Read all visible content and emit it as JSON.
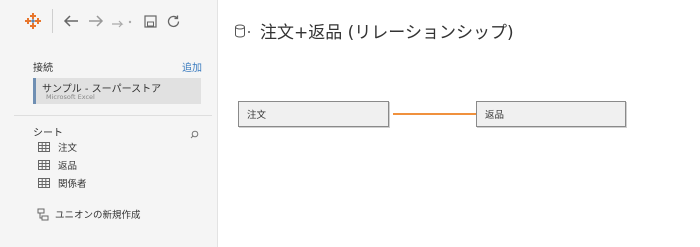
{
  "toolbar": {
    "icons": [
      "tableau-logo-icon",
      "back-arrow-icon",
      "forward-arrow-icon",
      "redo-icon",
      "save-icon",
      "refresh-icon"
    ]
  },
  "sidebar": {
    "connections_label": "接続",
    "add_label": "追加",
    "connection": {
      "name": "サンプル - スーパーストア",
      "type": "Microsoft Excel"
    },
    "sheets_label": "シート",
    "sheets": [
      {
        "label": "注文"
      },
      {
        "label": "返品"
      },
      {
        "label": "関係者"
      }
    ],
    "new_union_label": "ユニオンの新規作成"
  },
  "main": {
    "title": "注文+返品 (リレーションシップ)",
    "tables": [
      {
        "label": "注文"
      },
      {
        "label": "返品"
      }
    ],
    "relationship_color": "#f0913d"
  },
  "colors": {
    "accent": "#3a7bbf",
    "connection_bar": "#6f8fb3",
    "tableau_logo": "#e8762d"
  }
}
